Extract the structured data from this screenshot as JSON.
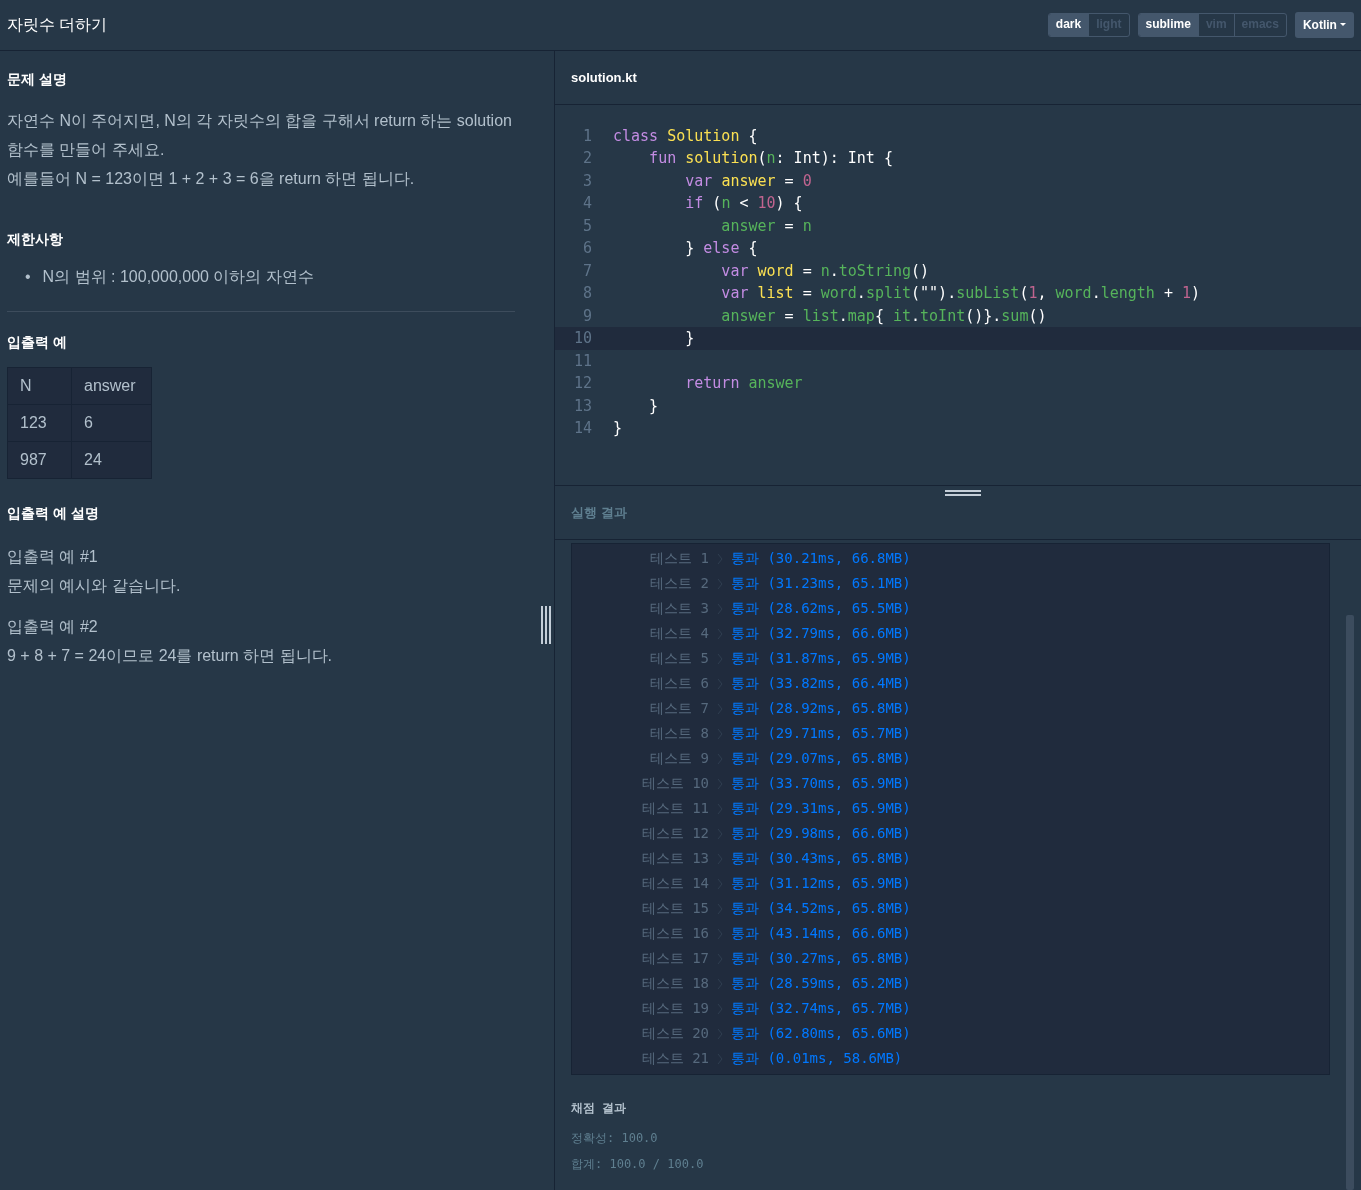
{
  "header": {
    "title": "자릿수 더하기",
    "theme_options": [
      {
        "label": "dark",
        "selected": true
      },
      {
        "label": "light",
        "selected": false
      }
    ],
    "keymap_options": [
      {
        "label": "sublime",
        "selected": true
      },
      {
        "label": "vim",
        "selected": false
      },
      {
        "label": "emacs",
        "selected": false
      }
    ],
    "language": "Kotlin"
  },
  "problem": {
    "description_heading": "문제 설명",
    "description": [
      "자연수 N이 주어지면, N의 각 자릿수의 합을 구해서 return 하는 solution 함수를 만들어 주세요.",
      "예를들어 N = 123이면 1 + 2 + 3 = 6을 return 하면 됩니다."
    ],
    "constraints_heading": "제한사항",
    "constraints": [
      {
        "bullet": "•",
        "text": "N의 범위 : 100,000,000 이하의 자연수"
      }
    ],
    "examples_heading": "입출력 예",
    "table": {
      "columns": [
        "N",
        "answer"
      ],
      "rows": [
        [
          "123",
          "6"
        ],
        [
          "987",
          "24"
        ]
      ]
    },
    "explanation_heading": "입출력 예 설명",
    "explanations": [
      {
        "title": "입출력 예 #1",
        "text": "문제의 예시와 같습니다."
      },
      {
        "title": "입출력 예 #2",
        "text": "9 + 8 + 7 = 24이므로 24를 return 하면 됩니다."
      }
    ]
  },
  "editor": {
    "filename": "solution.kt",
    "lines": [
      {
        "number": "1",
        "highlighted": false,
        "tokens": [
          {
            "kind": "keyword",
            "t": "class "
          },
          {
            "kind": "type",
            "t": "Solution"
          },
          {
            "kind": "plain",
            "t": " {"
          }
        ]
      },
      {
        "number": "2",
        "highlighted": false,
        "tokens": [
          {
            "kind": "keyword",
            "t": "    fun "
          },
          {
            "kind": "type",
            "t": "solution"
          },
          {
            "kind": "plain",
            "t": "("
          },
          {
            "kind": "ident",
            "t": "n"
          },
          {
            "kind": "plain",
            "t": ": Int): Int {"
          }
        ]
      },
      {
        "number": "3",
        "highlighted": false,
        "tokens": [
          {
            "kind": "keyword",
            "t": "        var "
          },
          {
            "kind": "type",
            "t": "answer"
          },
          {
            "kind": "plain",
            "t": " = "
          },
          {
            "kind": "number",
            "t": "0"
          }
        ]
      },
      {
        "number": "4",
        "highlighted": false,
        "tokens": [
          {
            "kind": "keyword",
            "t": "        if"
          },
          {
            "kind": "plain",
            "t": " ("
          },
          {
            "kind": "ident",
            "t": "n"
          },
          {
            "kind": "plain",
            "t": " < "
          },
          {
            "kind": "number",
            "t": "10"
          },
          {
            "kind": "plain",
            "t": ") {"
          }
        ]
      },
      {
        "number": "5",
        "highlighted": false,
        "tokens": [
          {
            "kind": "ident",
            "t": "            answer"
          },
          {
            "kind": "plain",
            "t": " = "
          },
          {
            "kind": "ident",
            "t": "n"
          }
        ]
      },
      {
        "number": "6",
        "highlighted": false,
        "tokens": [
          {
            "kind": "plain",
            "t": "        } "
          },
          {
            "kind": "keyword",
            "t": "else"
          },
          {
            "kind": "plain",
            "t": " {"
          }
        ]
      },
      {
        "number": "7",
        "highlighted": false,
        "tokens": [
          {
            "kind": "keyword",
            "t": "            var "
          },
          {
            "kind": "type",
            "t": "word"
          },
          {
            "kind": "plain",
            "t": " = "
          },
          {
            "kind": "ident",
            "t": "n"
          },
          {
            "kind": "plain",
            "t": "."
          },
          {
            "kind": "ident",
            "t": "toString"
          },
          {
            "kind": "plain",
            "t": "()"
          }
        ]
      },
      {
        "number": "8",
        "highlighted": false,
        "tokens": [
          {
            "kind": "keyword",
            "t": "            var "
          },
          {
            "kind": "type",
            "t": "list"
          },
          {
            "kind": "plain",
            "t": " = "
          },
          {
            "kind": "ident",
            "t": "word"
          },
          {
            "kind": "plain",
            "t": "."
          },
          {
            "kind": "ident",
            "t": "split"
          },
          {
            "kind": "plain",
            "t": "(\"\")."
          },
          {
            "kind": "ident",
            "t": "subList"
          },
          {
            "kind": "plain",
            "t": "("
          },
          {
            "kind": "number",
            "t": "1"
          },
          {
            "kind": "plain",
            "t": ", "
          },
          {
            "kind": "ident",
            "t": "word"
          },
          {
            "kind": "plain",
            "t": "."
          },
          {
            "kind": "ident",
            "t": "length"
          },
          {
            "kind": "plain",
            "t": " + "
          },
          {
            "kind": "number",
            "t": "1"
          },
          {
            "kind": "plain",
            "t": ")"
          }
        ]
      },
      {
        "number": "9",
        "highlighted": false,
        "tokens": [
          {
            "kind": "ident",
            "t": "            answer"
          },
          {
            "kind": "plain",
            "t": " = "
          },
          {
            "kind": "ident",
            "t": "list"
          },
          {
            "kind": "plain",
            "t": "."
          },
          {
            "kind": "ident",
            "t": "map"
          },
          {
            "kind": "plain",
            "t": "{ "
          },
          {
            "kind": "ident",
            "t": "it"
          },
          {
            "kind": "plain",
            "t": "."
          },
          {
            "kind": "ident",
            "t": "toInt"
          },
          {
            "kind": "plain",
            "t": "()}."
          },
          {
            "kind": "ident",
            "t": "sum"
          },
          {
            "kind": "plain",
            "t": "()"
          }
        ]
      },
      {
        "number": "10",
        "highlighted": true,
        "tokens": [
          {
            "kind": "plain",
            "t": "        }"
          }
        ]
      },
      {
        "number": "11",
        "highlighted": false
      },
      {
        "number": "12",
        "highlighted": false,
        "tokens": [
          {
            "kind": "keyword",
            "t": "        return "
          },
          {
            "kind": "ident",
            "t": "answer"
          }
        ]
      },
      {
        "number": "13",
        "highlighted": false,
        "tokens": [
          {
            "kind": "plain",
            "t": "    }"
          }
        ]
      },
      {
        "number": "14",
        "highlighted": false,
        "tokens": [
          {
            "kind": "plain",
            "t": "}"
          }
        ]
      }
    ]
  },
  "results": {
    "heading": "실행 결과",
    "tests": [
      {
        "label": "테스트 1",
        "result": "통과 (30.21ms, 66.8MB)",
        "passed": true
      },
      {
        "label": "테스트 2",
        "result": "통과 (31.23ms, 65.1MB)",
        "passed": true
      },
      {
        "label": "테스트 3",
        "result": "통과 (28.62ms, 65.5MB)",
        "passed": true
      },
      {
        "label": "테스트 4",
        "result": "통과 (32.79ms, 66.6MB)",
        "passed": true
      },
      {
        "label": "테스트 5",
        "result": "통과 (31.87ms, 65.9MB)",
        "passed": true
      },
      {
        "label": "테스트 6",
        "result": "통과 (33.82ms, 66.4MB)",
        "passed": true
      },
      {
        "label": "테스트 7",
        "result": "통과 (28.92ms, 65.8MB)",
        "passed": true
      },
      {
        "label": "테스트 8",
        "result": "통과 (29.71ms, 65.7MB)",
        "passed": true
      },
      {
        "label": "테스트 9",
        "result": "통과 (29.07ms, 65.8MB)",
        "passed": true
      },
      {
        "label": "테스트 10",
        "result": "통과 (33.70ms, 65.9MB)",
        "passed": true
      },
      {
        "label": "테스트 11",
        "result": "통과 (29.31ms, 65.9MB)",
        "passed": true
      },
      {
        "label": "테스트 12",
        "result": "통과 (29.98ms, 66.6MB)",
        "passed": true
      },
      {
        "label": "테스트 13",
        "result": "통과 (30.43ms, 65.8MB)",
        "passed": true
      },
      {
        "label": "테스트 14",
        "result": "통과 (31.12ms, 65.9MB)",
        "passed": true
      },
      {
        "label": "테스트 15",
        "result": "통과 (34.52ms, 65.8MB)",
        "passed": true
      },
      {
        "label": "테스트 16",
        "result": "통과 (43.14ms, 66.6MB)",
        "passed": true
      },
      {
        "label": "테스트 17",
        "result": "통과 (30.27ms, 65.8MB)",
        "passed": true
      },
      {
        "label": "테스트 18",
        "result": "통과 (28.59ms, 65.2MB)",
        "passed": true
      },
      {
        "label": "테스트 19",
        "result": "통과 (32.74ms, 65.7MB)",
        "passed": true
      },
      {
        "label": "테스트 20",
        "result": "통과 (62.80ms, 65.6MB)",
        "passed": true
      },
      {
        "label": "테스트 21",
        "result": "통과 (0.01ms, 58.6MB)",
        "passed": true
      }
    ],
    "score_heading": "채점 결과",
    "accuracy": "정확성: 100.0",
    "total": "합계: 100.0 / 100.0"
  }
}
